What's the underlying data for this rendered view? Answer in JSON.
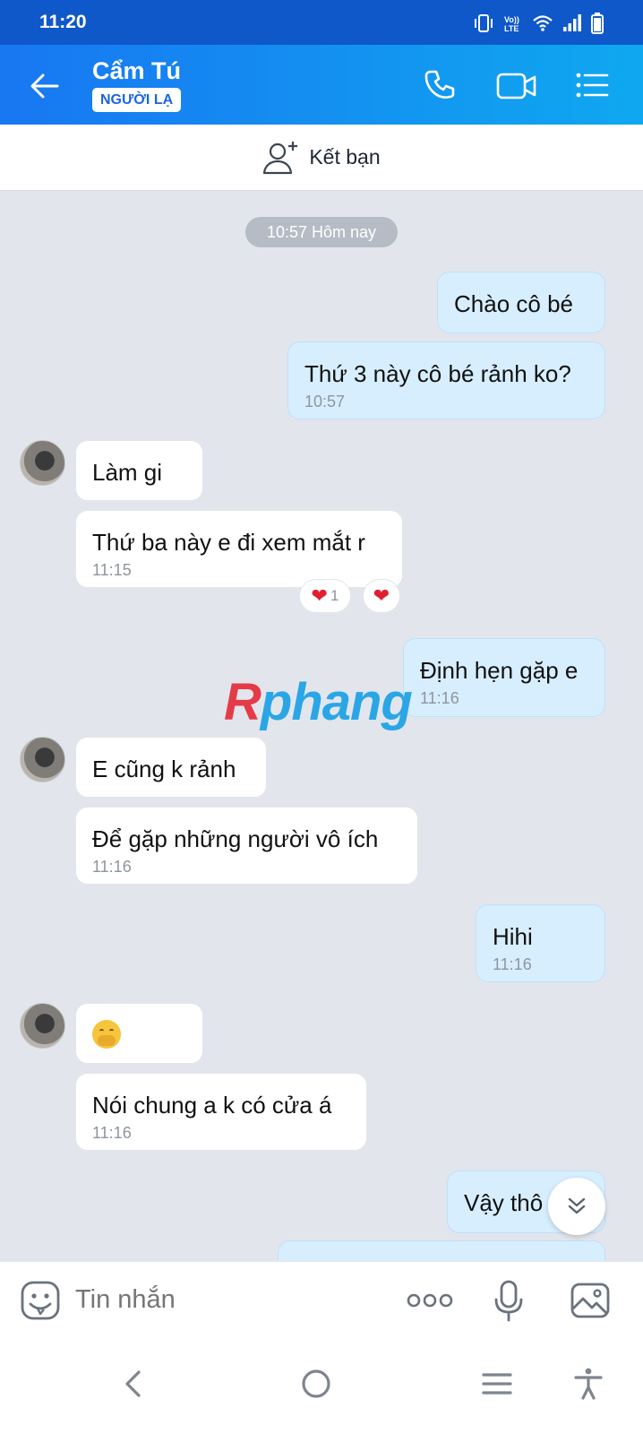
{
  "status_bar": {
    "time": "11:20"
  },
  "header": {
    "contact_name": "Cẩm Tú",
    "badge": "NGƯỜI LẠ"
  },
  "add_friend": {
    "label": "Kết bạn"
  },
  "chat": {
    "date_pill": "10:57 Hôm nay",
    "messages": [
      {
        "text": "Chào cô bé",
        "time": ""
      },
      {
        "text": "Thứ 3 này cô bé rảnh ko?",
        "time": "10:57"
      },
      {
        "text": "Làm gi",
        "time": ""
      },
      {
        "text": "Thứ ba này e đi xem mắt r",
        "time": "11:15"
      },
      {
        "text": "Định hẹn gặp e",
        "time": "11:16"
      },
      {
        "text": "E cũng k rảnh",
        "time": ""
      },
      {
        "text": "Để gặp những người vô ích",
        "time": "11:16"
      },
      {
        "text": "Hihi",
        "time": "11:16"
      },
      {
        "text": "",
        "time": "",
        "emoji": "hand-over-mouth-emoji"
      },
      {
        "text": "Nói chung a k có cửa á",
        "time": "11:16"
      },
      {
        "text": "Vậy thô",
        "time": ""
      }
    ],
    "reaction_count": "1",
    "watermark": {
      "r": "R",
      "rest": "phang"
    }
  },
  "composer": {
    "placeholder": "Tin nhắn"
  },
  "colors": {
    "header_start": "#1877f2",
    "header_end": "#0fa8f0",
    "status_bar": "#0f58c9",
    "outgoing_bubble": "#d7eeff",
    "incoming_bubble": "#ffffff",
    "chat_bg": "#e2e6ec",
    "heart": "#e0202e"
  },
  "icons": [
    "back-arrow-icon",
    "phone-icon",
    "video-call-icon",
    "menu-list-icon",
    "add-friend-icon",
    "sticker-icon",
    "more-options-icon",
    "microphone-icon",
    "image-icon",
    "nav-back-icon",
    "nav-home-icon",
    "nav-recents-icon",
    "accessibility-icon",
    "scroll-down-icon"
  ]
}
